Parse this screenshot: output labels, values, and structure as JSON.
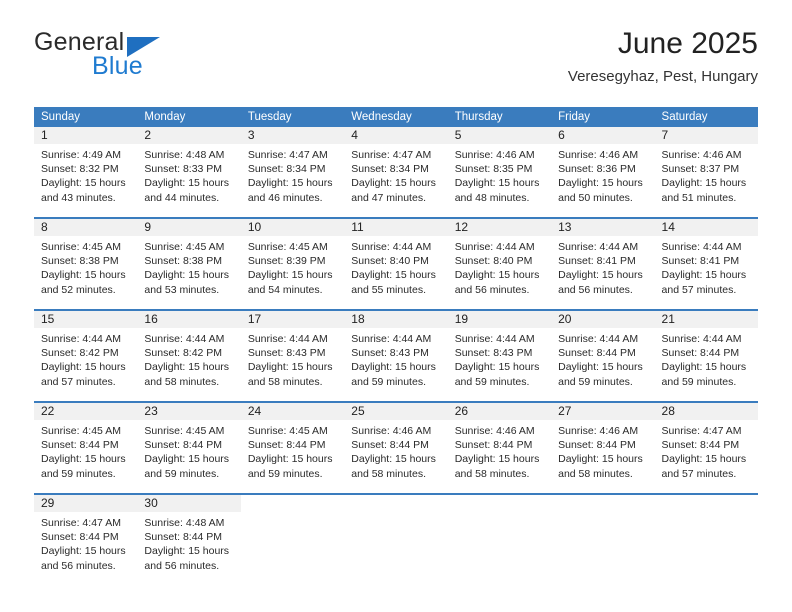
{
  "logo": {
    "word_one": "General",
    "word_two": "Blue",
    "triangle_color": "#1f6fc0",
    "blue_color": "#1f7bd0"
  },
  "header": {
    "title": "June 2025",
    "location": "Veresegyhaz, Pest, Hungary"
  },
  "calendar": {
    "header_bg": "#3a7cbe",
    "header_text_color": "#ffffff",
    "day_number_bg": "#f1f1f1",
    "weekdays": [
      "Sunday",
      "Monday",
      "Tuesday",
      "Wednesday",
      "Thursday",
      "Friday",
      "Saturday"
    ],
    "weeks": [
      [
        {
          "day": "1",
          "sunrise": "Sunrise: 4:49 AM",
          "sunset": "Sunset: 8:32 PM",
          "daylight": "Daylight: 15 hours and 43 minutes."
        },
        {
          "day": "2",
          "sunrise": "Sunrise: 4:48 AM",
          "sunset": "Sunset: 8:33 PM",
          "daylight": "Daylight: 15 hours and 44 minutes."
        },
        {
          "day": "3",
          "sunrise": "Sunrise: 4:47 AM",
          "sunset": "Sunset: 8:34 PM",
          "daylight": "Daylight: 15 hours and 46 minutes."
        },
        {
          "day": "4",
          "sunrise": "Sunrise: 4:47 AM",
          "sunset": "Sunset: 8:34 PM",
          "daylight": "Daylight: 15 hours and 47 minutes."
        },
        {
          "day": "5",
          "sunrise": "Sunrise: 4:46 AM",
          "sunset": "Sunset: 8:35 PM",
          "daylight": "Daylight: 15 hours and 48 minutes."
        },
        {
          "day": "6",
          "sunrise": "Sunrise: 4:46 AM",
          "sunset": "Sunset: 8:36 PM",
          "daylight": "Daylight: 15 hours and 50 minutes."
        },
        {
          "day": "7",
          "sunrise": "Sunrise: 4:46 AM",
          "sunset": "Sunset: 8:37 PM",
          "daylight": "Daylight: 15 hours and 51 minutes."
        }
      ],
      [
        {
          "day": "8",
          "sunrise": "Sunrise: 4:45 AM",
          "sunset": "Sunset: 8:38 PM",
          "daylight": "Daylight: 15 hours and 52 minutes."
        },
        {
          "day": "9",
          "sunrise": "Sunrise: 4:45 AM",
          "sunset": "Sunset: 8:38 PM",
          "daylight": "Daylight: 15 hours and 53 minutes."
        },
        {
          "day": "10",
          "sunrise": "Sunrise: 4:45 AM",
          "sunset": "Sunset: 8:39 PM",
          "daylight": "Daylight: 15 hours and 54 minutes."
        },
        {
          "day": "11",
          "sunrise": "Sunrise: 4:44 AM",
          "sunset": "Sunset: 8:40 PM",
          "daylight": "Daylight: 15 hours and 55 minutes."
        },
        {
          "day": "12",
          "sunrise": "Sunrise: 4:44 AM",
          "sunset": "Sunset: 8:40 PM",
          "daylight": "Daylight: 15 hours and 56 minutes."
        },
        {
          "day": "13",
          "sunrise": "Sunrise: 4:44 AM",
          "sunset": "Sunset: 8:41 PM",
          "daylight": "Daylight: 15 hours and 56 minutes."
        },
        {
          "day": "14",
          "sunrise": "Sunrise: 4:44 AM",
          "sunset": "Sunset: 8:41 PM",
          "daylight": "Daylight: 15 hours and 57 minutes."
        }
      ],
      [
        {
          "day": "15",
          "sunrise": "Sunrise: 4:44 AM",
          "sunset": "Sunset: 8:42 PM",
          "daylight": "Daylight: 15 hours and 57 minutes."
        },
        {
          "day": "16",
          "sunrise": "Sunrise: 4:44 AM",
          "sunset": "Sunset: 8:42 PM",
          "daylight": "Daylight: 15 hours and 58 minutes."
        },
        {
          "day": "17",
          "sunrise": "Sunrise: 4:44 AM",
          "sunset": "Sunset: 8:43 PM",
          "daylight": "Daylight: 15 hours and 58 minutes."
        },
        {
          "day": "18",
          "sunrise": "Sunrise: 4:44 AM",
          "sunset": "Sunset: 8:43 PM",
          "daylight": "Daylight: 15 hours and 59 minutes."
        },
        {
          "day": "19",
          "sunrise": "Sunrise: 4:44 AM",
          "sunset": "Sunset: 8:43 PM",
          "daylight": "Daylight: 15 hours and 59 minutes."
        },
        {
          "day": "20",
          "sunrise": "Sunrise: 4:44 AM",
          "sunset": "Sunset: 8:44 PM",
          "daylight": "Daylight: 15 hours and 59 minutes."
        },
        {
          "day": "21",
          "sunrise": "Sunrise: 4:44 AM",
          "sunset": "Sunset: 8:44 PM",
          "daylight": "Daylight: 15 hours and 59 minutes."
        }
      ],
      [
        {
          "day": "22",
          "sunrise": "Sunrise: 4:45 AM",
          "sunset": "Sunset: 8:44 PM",
          "daylight": "Daylight: 15 hours and 59 minutes."
        },
        {
          "day": "23",
          "sunrise": "Sunrise: 4:45 AM",
          "sunset": "Sunset: 8:44 PM",
          "daylight": "Daylight: 15 hours and 59 minutes."
        },
        {
          "day": "24",
          "sunrise": "Sunrise: 4:45 AM",
          "sunset": "Sunset: 8:44 PM",
          "daylight": "Daylight: 15 hours and 59 minutes."
        },
        {
          "day": "25",
          "sunrise": "Sunrise: 4:46 AM",
          "sunset": "Sunset: 8:44 PM",
          "daylight": "Daylight: 15 hours and 58 minutes."
        },
        {
          "day": "26",
          "sunrise": "Sunrise: 4:46 AM",
          "sunset": "Sunset: 8:44 PM",
          "daylight": "Daylight: 15 hours and 58 minutes."
        },
        {
          "day": "27",
          "sunrise": "Sunrise: 4:46 AM",
          "sunset": "Sunset: 8:44 PM",
          "daylight": "Daylight: 15 hours and 58 minutes."
        },
        {
          "day": "28",
          "sunrise": "Sunrise: 4:47 AM",
          "sunset": "Sunset: 8:44 PM",
          "daylight": "Daylight: 15 hours and 57 minutes."
        }
      ],
      [
        {
          "day": "29",
          "sunrise": "Sunrise: 4:47 AM",
          "sunset": "Sunset: 8:44 PM",
          "daylight": "Daylight: 15 hours and 56 minutes."
        },
        {
          "day": "30",
          "sunrise": "Sunrise: 4:48 AM",
          "sunset": "Sunset: 8:44 PM",
          "daylight": "Daylight: 15 hours and 56 minutes."
        },
        {
          "day": "",
          "sunrise": "",
          "sunset": "",
          "daylight": ""
        },
        {
          "day": "",
          "sunrise": "",
          "sunset": "",
          "daylight": ""
        },
        {
          "day": "",
          "sunrise": "",
          "sunset": "",
          "daylight": ""
        },
        {
          "day": "",
          "sunrise": "",
          "sunset": "",
          "daylight": ""
        },
        {
          "day": "",
          "sunrise": "",
          "sunset": "",
          "daylight": ""
        }
      ]
    ]
  }
}
